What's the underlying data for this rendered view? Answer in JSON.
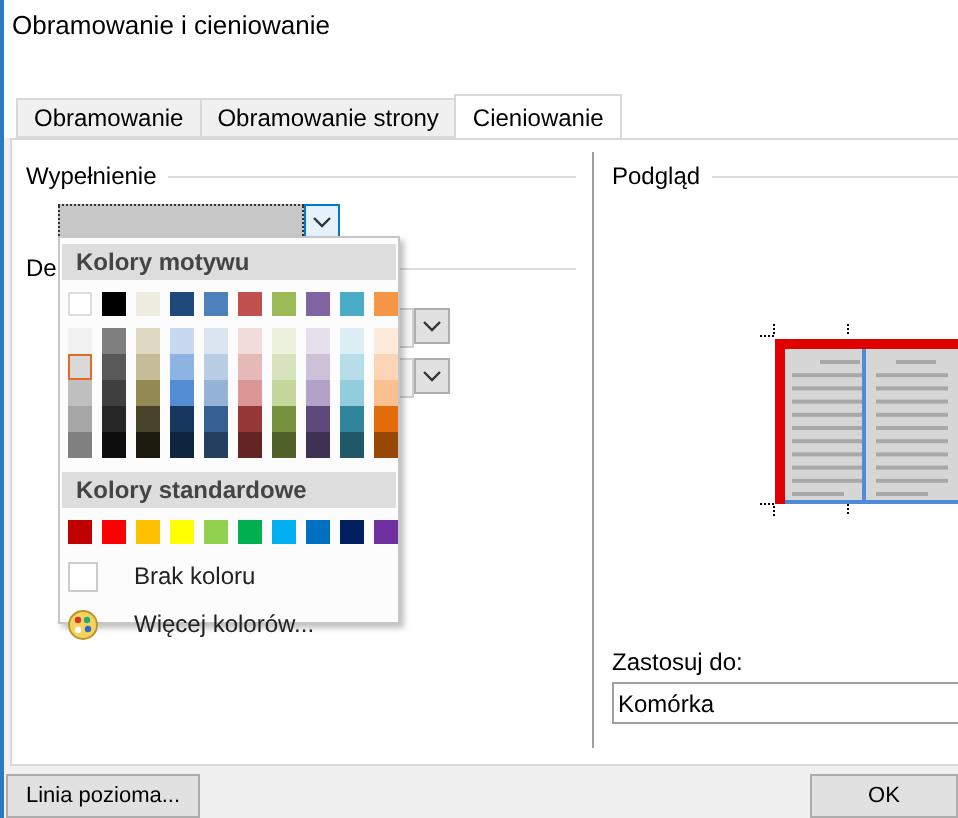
{
  "window": {
    "title": "Obramowanie i cieniowanie"
  },
  "tabs": [
    {
      "label": "Obramowanie",
      "selected": false
    },
    {
      "label": "Obramowanie strony",
      "selected": false
    },
    {
      "label": "Cieniowanie",
      "selected": true
    }
  ],
  "fill_section": {
    "label": "Wypełnienie",
    "dropdown": {
      "expanded": true
    }
  },
  "pattern_section": {
    "label": "De"
  },
  "color_picker": {
    "theme_heading": "Kolory motywu",
    "theme_rows": [
      [
        {
          "color": "#ffffff",
          "selected": false
        },
        {
          "color": "#000000",
          "selected": false
        },
        {
          "color": "#eeece1",
          "selected": false
        },
        {
          "color": "#1f497d",
          "selected": false
        },
        {
          "color": "#4f81bd",
          "selected": false
        },
        {
          "color": "#c0504d",
          "selected": false
        },
        {
          "color": "#9bbb59",
          "selected": false
        },
        {
          "color": "#8064a2",
          "selected": false
        },
        {
          "color": "#4bacc6",
          "selected": false
        },
        {
          "color": "#f79646",
          "selected": false
        }
      ],
      [
        {
          "color": "#f2f2f2",
          "selected": false
        },
        {
          "color": "#7f7f7f",
          "selected": false
        },
        {
          "color": "#ddd9c3",
          "selected": false
        },
        {
          "color": "#c6d9f0",
          "selected": false
        },
        {
          "color": "#dbe5f1",
          "selected": false
        },
        {
          "color": "#f2dcdb",
          "selected": false
        },
        {
          "color": "#ebf1dd",
          "selected": false
        },
        {
          "color": "#e5e0ec",
          "selected": false
        },
        {
          "color": "#dbeef3",
          "selected": false
        },
        {
          "color": "#fdeada",
          "selected": false
        }
      ],
      [
        {
          "color": "#d9d9d9",
          "selected": true
        },
        {
          "color": "#595959",
          "selected": false
        },
        {
          "color": "#c4bd97",
          "selected": false
        },
        {
          "color": "#8db3e2",
          "selected": false
        },
        {
          "color": "#b8cce4",
          "selected": false
        },
        {
          "color": "#e5b9b7",
          "selected": false
        },
        {
          "color": "#d7e3bc",
          "selected": false
        },
        {
          "color": "#ccc1d9",
          "selected": false
        },
        {
          "color": "#b7dde8",
          "selected": false
        },
        {
          "color": "#fbd5b5",
          "selected": false
        }
      ],
      [
        {
          "color": "#bfbfbf",
          "selected": false
        },
        {
          "color": "#404040",
          "selected": false
        },
        {
          "color": "#938953",
          "selected": false
        },
        {
          "color": "#548dd4",
          "selected": false
        },
        {
          "color": "#95b3d7",
          "selected": false
        },
        {
          "color": "#d99694",
          "selected": false
        },
        {
          "color": "#c3d69b",
          "selected": false
        },
        {
          "color": "#b2a2c7",
          "selected": false
        },
        {
          "color": "#92cddc",
          "selected": false
        },
        {
          "color": "#fac08f",
          "selected": false
        }
      ],
      [
        {
          "color": "#a6a6a6",
          "selected": false
        },
        {
          "color": "#262626",
          "selected": false
        },
        {
          "color": "#494429",
          "selected": false
        },
        {
          "color": "#17365d",
          "selected": false
        },
        {
          "color": "#366092",
          "selected": false
        },
        {
          "color": "#953734",
          "selected": false
        },
        {
          "color": "#76923c",
          "selected": false
        },
        {
          "color": "#5f497a",
          "selected": false
        },
        {
          "color": "#31859b",
          "selected": false
        },
        {
          "color": "#e36c09",
          "selected": false
        }
      ],
      [
        {
          "color": "#808080",
          "selected": false
        },
        {
          "color": "#0d0d0d",
          "selected": false
        },
        {
          "color": "#1d1b10",
          "selected": false
        },
        {
          "color": "#0f243e",
          "selected": false
        },
        {
          "color": "#244061",
          "selected": false
        },
        {
          "color": "#632423",
          "selected": false
        },
        {
          "color": "#4f6128",
          "selected": false
        },
        {
          "color": "#3f3151",
          "selected": false
        },
        {
          "color": "#205867",
          "selected": false
        },
        {
          "color": "#974806",
          "selected": false
        }
      ]
    ],
    "standard_heading": "Kolory standardowe",
    "standard_colors": [
      {
        "color": "#c00000",
        "selected": false
      },
      {
        "color": "#ff0000",
        "selected": false
      },
      {
        "color": "#ffc000",
        "selected": false
      },
      {
        "color": "#ffff00",
        "selected": false
      },
      {
        "color": "#92d050",
        "selected": false
      },
      {
        "color": "#00b050",
        "selected": false
      },
      {
        "color": "#00b0f0",
        "selected": false
      },
      {
        "color": "#0070c0",
        "selected": false
      },
      {
        "color": "#002060",
        "selected": false
      },
      {
        "color": "#7030a0",
        "selected": false
      }
    ],
    "items": [
      {
        "kind": "none",
        "label": "Brak koloru"
      },
      {
        "kind": "more",
        "label": "Więcej kolorów..."
      }
    ]
  },
  "preview": {
    "label": "Podgląd"
  },
  "apply_to": {
    "label": "Zastosuj do:",
    "value": "Komórka"
  },
  "buttons": [
    {
      "label": "Linia pozioma..."
    },
    {
      "label": "OK"
    }
  ]
}
